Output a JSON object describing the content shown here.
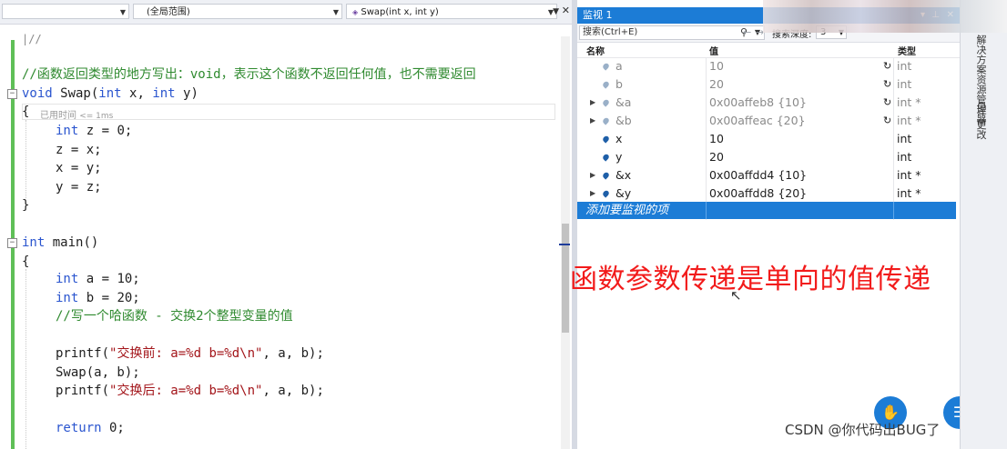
{
  "editor": {
    "nav": {
      "scope_left": "",
      "scope_middle": "(全局范围)",
      "scope_right": "Swap(int x, int y)"
    },
    "prefix_line": "|//",
    "comment_line": "//函数返回类型的地方写出：void，表示这个函数不返回任何值，也不需要返回",
    "swap_signature": {
      "kw_void": "void",
      "name": " Swap(",
      "kw_int1": "int",
      "x": " x, ",
      "kw_int2": "int",
      "y": " y)"
    },
    "open_brace": "{",
    "elapsed_label": "已用时间",
    "elapsed_value": "<= 1ms",
    "swap_body": [
      {
        "kw": "int",
        "rest": " z = 0;"
      },
      {
        "kw": "",
        "rest": "z = x;"
      },
      {
        "kw": "",
        "rest": "x = y;"
      },
      {
        "kw": "",
        "rest": "y = z;"
      }
    ],
    "close_brace": "}",
    "main_signature": {
      "kw_int": "int",
      "name": " main()"
    },
    "main_open": "{",
    "main_decl_a": {
      "kw": "int",
      "rest": " a = 10;"
    },
    "main_decl_b": {
      "kw": "int",
      "rest": " b = 20;"
    },
    "main_comment": "//写一个哈函数 - 交换2个整型变量的值",
    "printf_before": {
      "fn": "printf(",
      "str": "\"交换前: a=%d b=%d\\n\"",
      "rest": ", a, b);"
    },
    "swap_call": "Swap(a, b);",
    "printf_after": {
      "fn": "printf(",
      "str": "\"交换后: a=%d b=%d\\n\"",
      "rest": ", a, b);"
    },
    "return_line": {
      "kw": "return",
      "rest": " 0;"
    }
  },
  "watch": {
    "title": "监视 1",
    "search_placeholder": "搜索(Ctrl+E)",
    "depth_label": "搜索深度:",
    "depth_value": "3",
    "columns": {
      "name": "名称",
      "value": "值",
      "type": "类型"
    },
    "rows": [
      {
        "name": "a",
        "value": "10",
        "type": "int",
        "expandable": false,
        "stale": true
      },
      {
        "name": "b",
        "value": "20",
        "type": "int",
        "expandable": false,
        "stale": true
      },
      {
        "name": "&a",
        "value": "0x00affeb8 {10}",
        "type": "int *",
        "expandable": true,
        "stale": true
      },
      {
        "name": "&b",
        "value": "0x00affeac {20}",
        "type": "int *",
        "expandable": true,
        "stale": true
      },
      {
        "name": "x",
        "value": "10",
        "type": "int",
        "expandable": false,
        "stale": false
      },
      {
        "name": "y",
        "value": "20",
        "type": "int",
        "expandable": false,
        "stale": false
      },
      {
        "name": "&x",
        "value": "0x00affdd4 {10}",
        "type": "int *",
        "expandable": true,
        "stale": false
      },
      {
        "name": "&y",
        "value": "0x00affdd8 {20}",
        "type": "int *",
        "expandable": true,
        "stale": false
      }
    ],
    "add_item": "添加要监视的项"
  },
  "caption": "函数参数传递是单向的值传递",
  "side_tabs": {
    "tab1": "解决方案资源管理器",
    "tab2": "Git 更改"
  },
  "watermark": "CSDN @你代码出BUG了",
  "colors": {
    "accent": "#1c7cd6",
    "keyword": "#2a55cf",
    "comment": "#2f8a2f",
    "string": "#a3151a",
    "caption": "#f21b1b"
  }
}
